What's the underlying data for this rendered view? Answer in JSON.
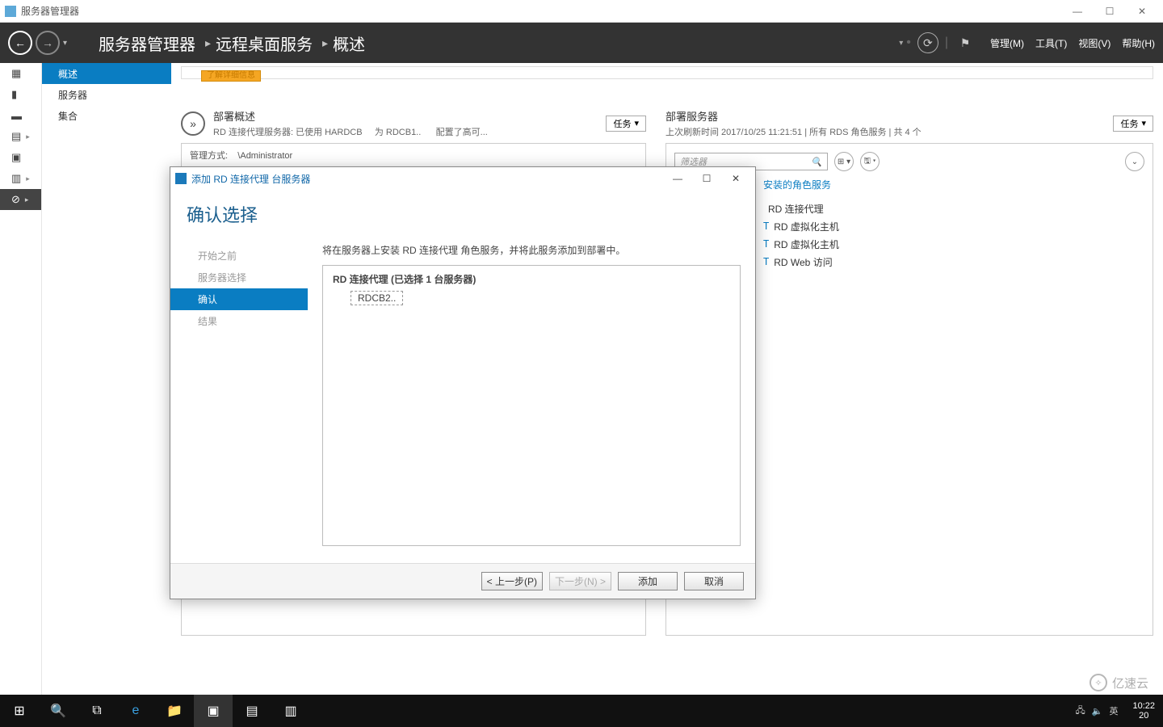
{
  "titlebar": {
    "title": "服务器管理器"
  },
  "breadcrumb": {
    "root": "服务器管理器",
    "section": "远程桌面服务",
    "page": "概述"
  },
  "menus": {
    "manage": "管理(M)",
    "tools": "工具(T)",
    "view": "视图(V)",
    "help": "帮助(H)"
  },
  "nav": {
    "overview": "概述",
    "servers": "服务器",
    "collections": "集合"
  },
  "banner": {
    "detail_link": "了解详细信息"
  },
  "deploy_overview": {
    "title": "部署概述",
    "subtitle_a": "RD 连接代理服务器: 已使用 HARDCB",
    "subtitle_b": "为 RDCB1..",
    "subtitle_c": "配置了高可...",
    "tasks": "任务",
    "manage_label": "管理方式:",
    "manage_value": "\\Administrator"
  },
  "deploy_servers": {
    "title": "部署服务器",
    "refreshed": "上次刷新时间 2017/10/25 11:21:51 | 所有 RDS 角色服务  | 共 4 个",
    "tasks": "任务",
    "filter_placeholder": "筛选器",
    "roles_header": "安装的角色服务",
    "roles": [
      "RD 连接代理",
      "RD 虚拟化主机",
      "RD 虚拟化主机",
      "RD Web 访问"
    ],
    "markers": [
      "",
      "T",
      "T",
      "T"
    ]
  },
  "wizard": {
    "window_title": "添加 RD 连接代理 台服务器",
    "heading": "确认选择",
    "steps": {
      "s1": "开始之前",
      "s2": "服务器选择",
      "s3": "确认",
      "s4": "结果"
    },
    "desc": "将在服务器上安装 RD 连接代理 角色服务，并将此服务添加到部署中。",
    "box_header": "RD 连接代理  (已选择 1 台服务器)",
    "server": "RDCB2..",
    "buttons": {
      "prev": "< 上一步(P)",
      "next": "下一步(N) >",
      "add": "添加",
      "cancel": "取消"
    }
  },
  "taskbar": {
    "time": "10:22",
    "date": "20",
    "ime": "英"
  },
  "watermark": "亿速云"
}
